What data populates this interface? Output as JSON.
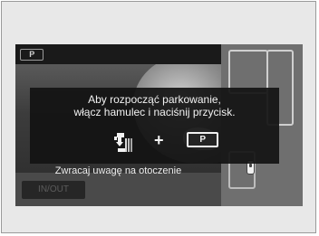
{
  "screen": {
    "mode_icon_label": "P",
    "dialog": {
      "message_line1": "Aby rozpocząć parkowanie,",
      "message_line2": "włącz hamulec i naciśnij przycisk.",
      "plus_sign": "+",
      "p_button_label": "P",
      "brake_icon": "brake-pedal-icon",
      "button_icon": "parking-assist-button-icon"
    },
    "bottom_note": "Zwracaj uwagę na otoczenie",
    "inout_button_label": "IN/OUT"
  }
}
